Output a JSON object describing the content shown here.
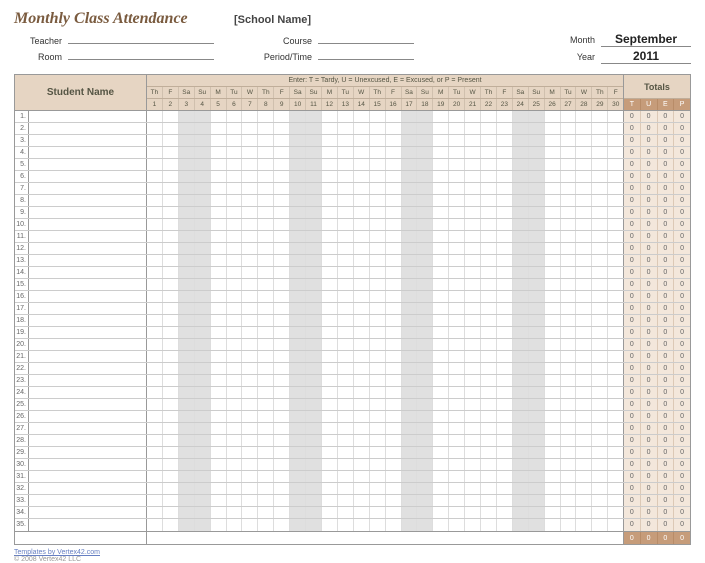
{
  "title": "Monthly Class Attendance",
  "school_placeholder": "[School Name]",
  "labels": {
    "teacher": "Teacher",
    "room": "Room",
    "course": "Course",
    "period": "Period/Time",
    "month": "Month",
    "year": "Year",
    "student_name": "Student Name",
    "totals": "Totals",
    "legend": "Enter:  T = Tardy,   U = Unexcused,   E = Excused,  or P = Present"
  },
  "values": {
    "month": "September",
    "year": "2011"
  },
  "days": [
    {
      "dow": "Th",
      "n": 1,
      "we": false
    },
    {
      "dow": "F",
      "n": 2,
      "we": false
    },
    {
      "dow": "Sa",
      "n": 3,
      "we": true
    },
    {
      "dow": "Su",
      "n": 4,
      "we": true
    },
    {
      "dow": "M",
      "n": 5,
      "we": false
    },
    {
      "dow": "Tu",
      "n": 6,
      "we": false
    },
    {
      "dow": "W",
      "n": 7,
      "we": false
    },
    {
      "dow": "Th",
      "n": 8,
      "we": false
    },
    {
      "dow": "F",
      "n": 9,
      "we": false
    },
    {
      "dow": "Sa",
      "n": 10,
      "we": true
    },
    {
      "dow": "Su",
      "n": 11,
      "we": true
    },
    {
      "dow": "M",
      "n": 12,
      "we": false
    },
    {
      "dow": "Tu",
      "n": 13,
      "we": false
    },
    {
      "dow": "W",
      "n": 14,
      "we": false
    },
    {
      "dow": "Th",
      "n": 15,
      "we": false
    },
    {
      "dow": "F",
      "n": 16,
      "we": false
    },
    {
      "dow": "Sa",
      "n": 17,
      "we": true
    },
    {
      "dow": "Su",
      "n": 18,
      "we": true
    },
    {
      "dow": "M",
      "n": 19,
      "we": false
    },
    {
      "dow": "Tu",
      "n": 20,
      "we": false
    },
    {
      "dow": "W",
      "n": 21,
      "we": false
    },
    {
      "dow": "Th",
      "n": 22,
      "we": false
    },
    {
      "dow": "F",
      "n": 23,
      "we": false
    },
    {
      "dow": "Sa",
      "n": 24,
      "we": true
    },
    {
      "dow": "Su",
      "n": 25,
      "we": true
    },
    {
      "dow": "M",
      "n": 26,
      "we": false
    },
    {
      "dow": "Tu",
      "n": 27,
      "we": false
    },
    {
      "dow": "W",
      "n": 28,
      "we": false
    },
    {
      "dow": "Th",
      "n": 29,
      "we": false
    },
    {
      "dow": "F",
      "n": 30,
      "we": false
    }
  ],
  "total_cols": [
    "T",
    "U",
    "E",
    "P"
  ],
  "row_count": 35,
  "total_default": "0",
  "footer_totals": [
    "0",
    "0",
    "0",
    "0"
  ],
  "credits_link": "Templates by Vertex42.com",
  "copyright": "© 2008 Vertex42 LLC"
}
